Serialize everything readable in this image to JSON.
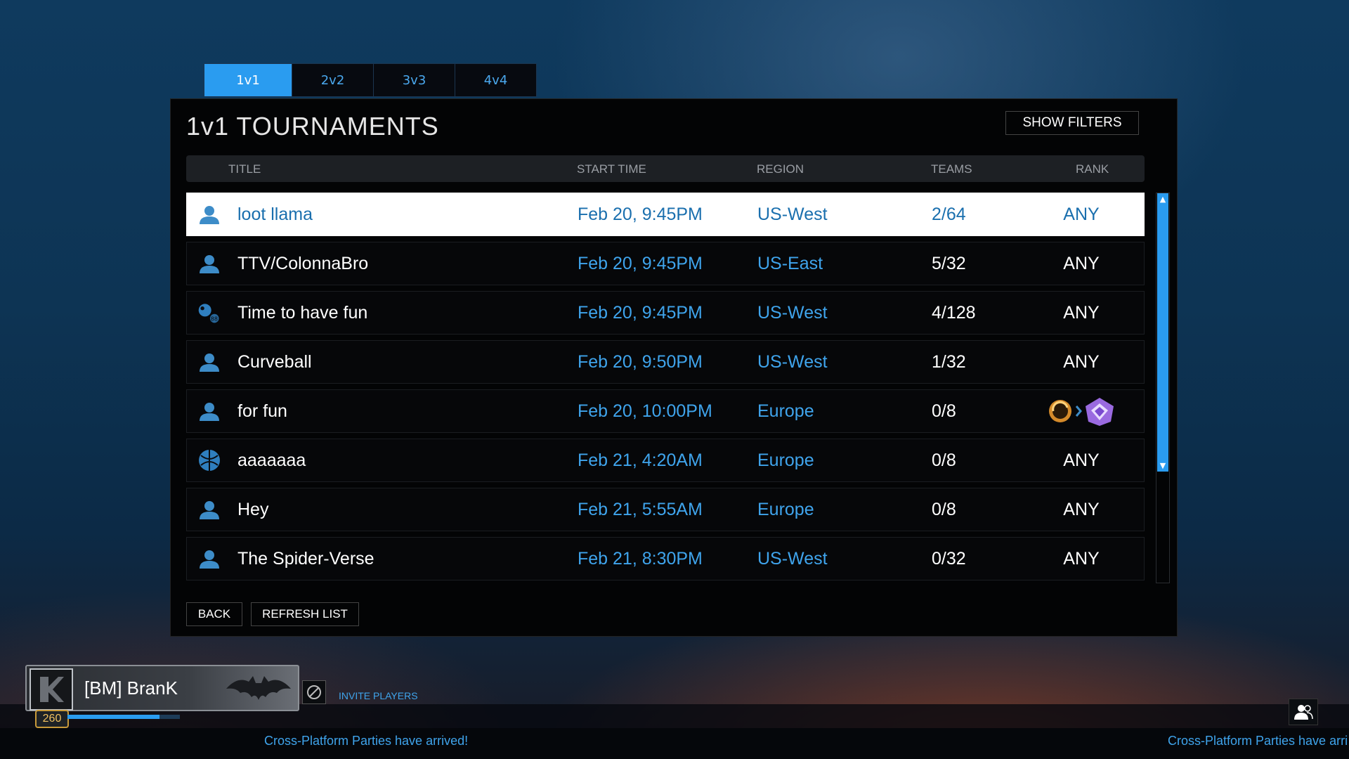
{
  "tabs": [
    {
      "label": "1v1",
      "active": true
    },
    {
      "label": "2v2",
      "active": false
    },
    {
      "label": "3v3",
      "active": false
    },
    {
      "label": "4v4",
      "active": false
    }
  ],
  "panel": {
    "title": "1v1 TOURNAMENTS",
    "show_filters_label": "SHOW FILTERS",
    "columns": {
      "title": "TITLE",
      "start_time": "START TIME",
      "region": "REGION",
      "teams": "TEAMS",
      "rank": "RANK"
    }
  },
  "rows": [
    {
      "icon": "person-icon",
      "title": "loot llama",
      "start_time": "Feb 20, 9:45PM",
      "region": "US-West",
      "teams": "2/64",
      "rank": "ANY",
      "selected": true
    },
    {
      "icon": "person-icon",
      "title": "TTV/ColonnaBro",
      "start_time": "Feb 20, 9:45PM",
      "region": "US-East",
      "teams": "5/32",
      "rank": "ANY"
    },
    {
      "icon": "club-icon",
      "title": "Time to have fun",
      "start_time": "Feb 20, 9:45PM",
      "region": "US-West",
      "teams": "4/128",
      "rank": "ANY"
    },
    {
      "icon": "person-icon",
      "title": "Curveball",
      "start_time": "Feb 20, 9:50PM",
      "region": "US-West",
      "teams": "1/32",
      "rank": "ANY"
    },
    {
      "icon": "person-icon",
      "title": "for fun",
      "start_time": "Feb 20, 10:00PM",
      "region": "Europe",
      "teams": "0/8",
      "rank": "",
      "rank_range": [
        "gold-rank-icon",
        "grand-champion-rank-icon"
      ]
    },
    {
      "icon": "ball-icon",
      "title": "aaaaaaa",
      "start_time": "Feb 21, 4:20AM",
      "region": "Europe",
      "teams": "0/8",
      "rank": "ANY"
    },
    {
      "icon": "person-icon",
      "title": "Hey",
      "start_time": "Feb 21, 5:55AM",
      "region": "Europe",
      "teams": "0/8",
      "rank": "ANY"
    },
    {
      "icon": "person-icon",
      "title": "The Spider-Verse",
      "start_time": "Feb 21, 8:30PM",
      "region": "US-West",
      "teams": "0/32",
      "rank": "ANY"
    }
  ],
  "buttons": {
    "back": "BACK",
    "refresh": "REFRESH LIST"
  },
  "player": {
    "name": "[BM] BranK",
    "level": "260",
    "xp_fraction": 0.82
  },
  "invite_label": "INVITE PLAYERS",
  "ticker": [
    "Cross-Platform Parties have arrived!",
    "Cross-Platform Parties have arri"
  ],
  "colors": {
    "accent": "#2a9cf0",
    "text_blue": "#3fa4ec",
    "selected_text": "#1a6fae",
    "panel_bg": "#030405"
  }
}
